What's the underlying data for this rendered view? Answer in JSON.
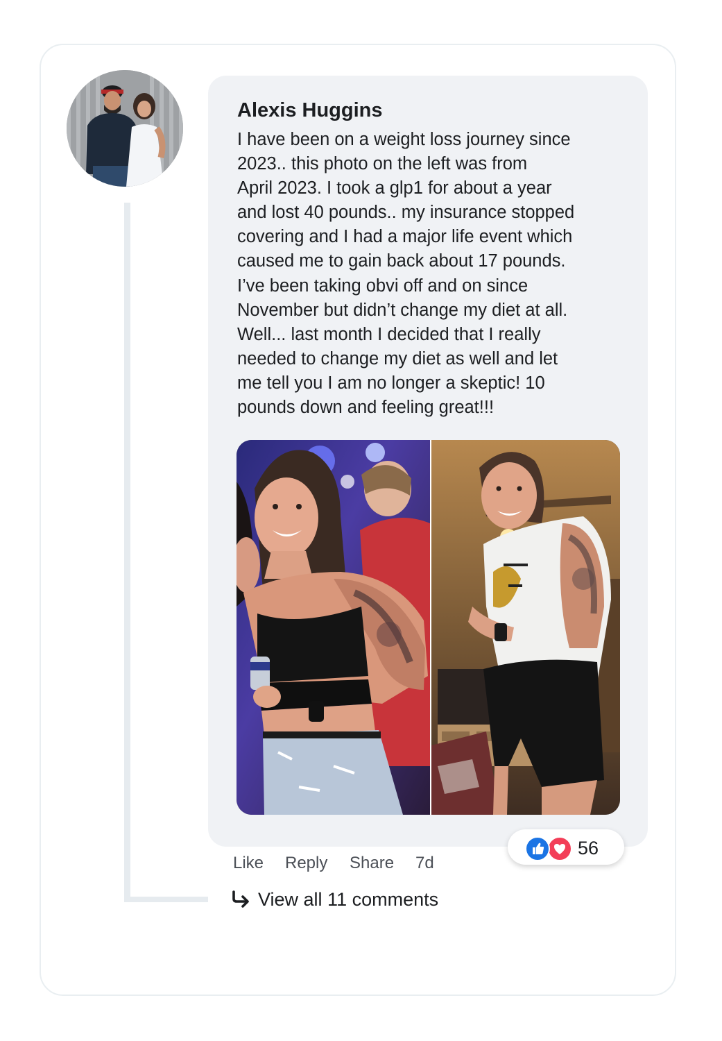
{
  "comment": {
    "author": "Alexis Huggins",
    "text_lines": [
      "I have been on a weight loss journey since",
      "2023.. this photo on the left was from",
      "April 2023. I took a glp1 for about a year",
      "and lost 40 pounds.. my insurance stopped",
      "covering and I had a major life event which",
      "caused me to gain back about 17 pounds.",
      "I’ve been taking obvi off and on since",
      "November but didn’t change my diet at all.",
      "Well... last month I decided that I really",
      "needed to change my diet as well and let",
      "me tell you I am no longer a skeptic! 10",
      "pounds down and feeling great!!!"
    ],
    "avatar_icon": "profile-photo",
    "photos": [
      "before-photo",
      "after-photo"
    ]
  },
  "reactions": {
    "icons": [
      "like-reaction-icon",
      "love-reaction-icon"
    ],
    "count": "56",
    "like_color": "#1b74e4",
    "love_color": "#f33e58"
  },
  "actions": {
    "like": "Like",
    "reply": "Reply",
    "share": "Share",
    "time": "7d"
  },
  "thread": {
    "view_all": "View all 11 comments",
    "arrow_icon": "reply-arrow-icon"
  },
  "colors": {
    "bubble": "#f0f2f5",
    "thread_line": "#e6ebef",
    "card_border": "#e9eef1"
  }
}
